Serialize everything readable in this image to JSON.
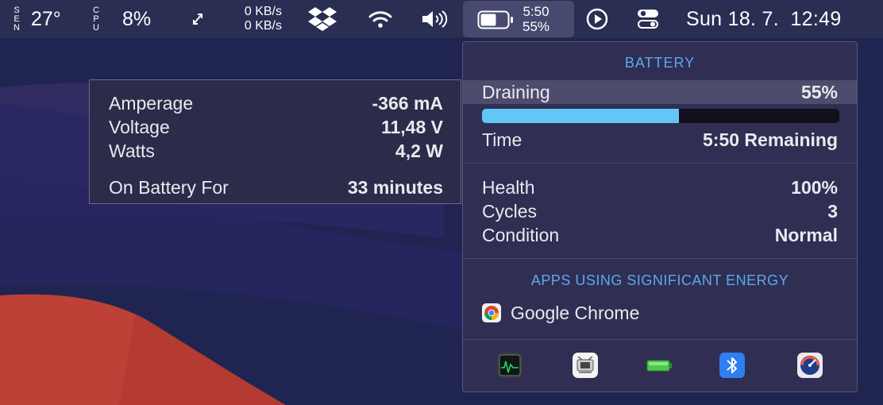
{
  "menubar": {
    "sensor_label": "SEN",
    "temperature": "27°",
    "cpu_label": "CPU",
    "cpu_value": "8%",
    "net_up": "0 KB/s",
    "net_down": "0 KB/s",
    "battery_time": "5:50",
    "battery_percent": "55%",
    "datetime": "Sun 18. 7.  12:49"
  },
  "tooltip": {
    "rows": [
      {
        "label": "Amperage",
        "value": "-366 mA"
      },
      {
        "label": "Voltage",
        "value": "11,48 V"
      },
      {
        "label": "Watts",
        "value": "4,2 W"
      }
    ],
    "on_battery_label": "On Battery For",
    "on_battery_value": "33 minutes"
  },
  "battery_menu": {
    "header": "BATTERY",
    "status_label": "Draining",
    "status_value": "55%",
    "charge_fraction": 0.55,
    "time_label": "Time",
    "time_value": "5:50 Remaining",
    "health_label": "Health",
    "health_value": "100%",
    "cycles_label": "Cycles",
    "cycles_value": "3",
    "condition_label": "Condition",
    "condition_value": "Normal",
    "apps_header": "APPS USING SIGNIFICANT ENERGY",
    "apps": [
      "Google Chrome"
    ],
    "footer_icons": [
      "activity-monitor-icon",
      "system-information-icon",
      "battery-icon",
      "bluetooth-icon",
      "disk-diag-icon"
    ]
  },
  "colors": {
    "accent": "#5aa9ee",
    "charge_bar": "#62c6f6",
    "menubar_bg": "#2a2e52",
    "popover_bg": "#302e52"
  }
}
